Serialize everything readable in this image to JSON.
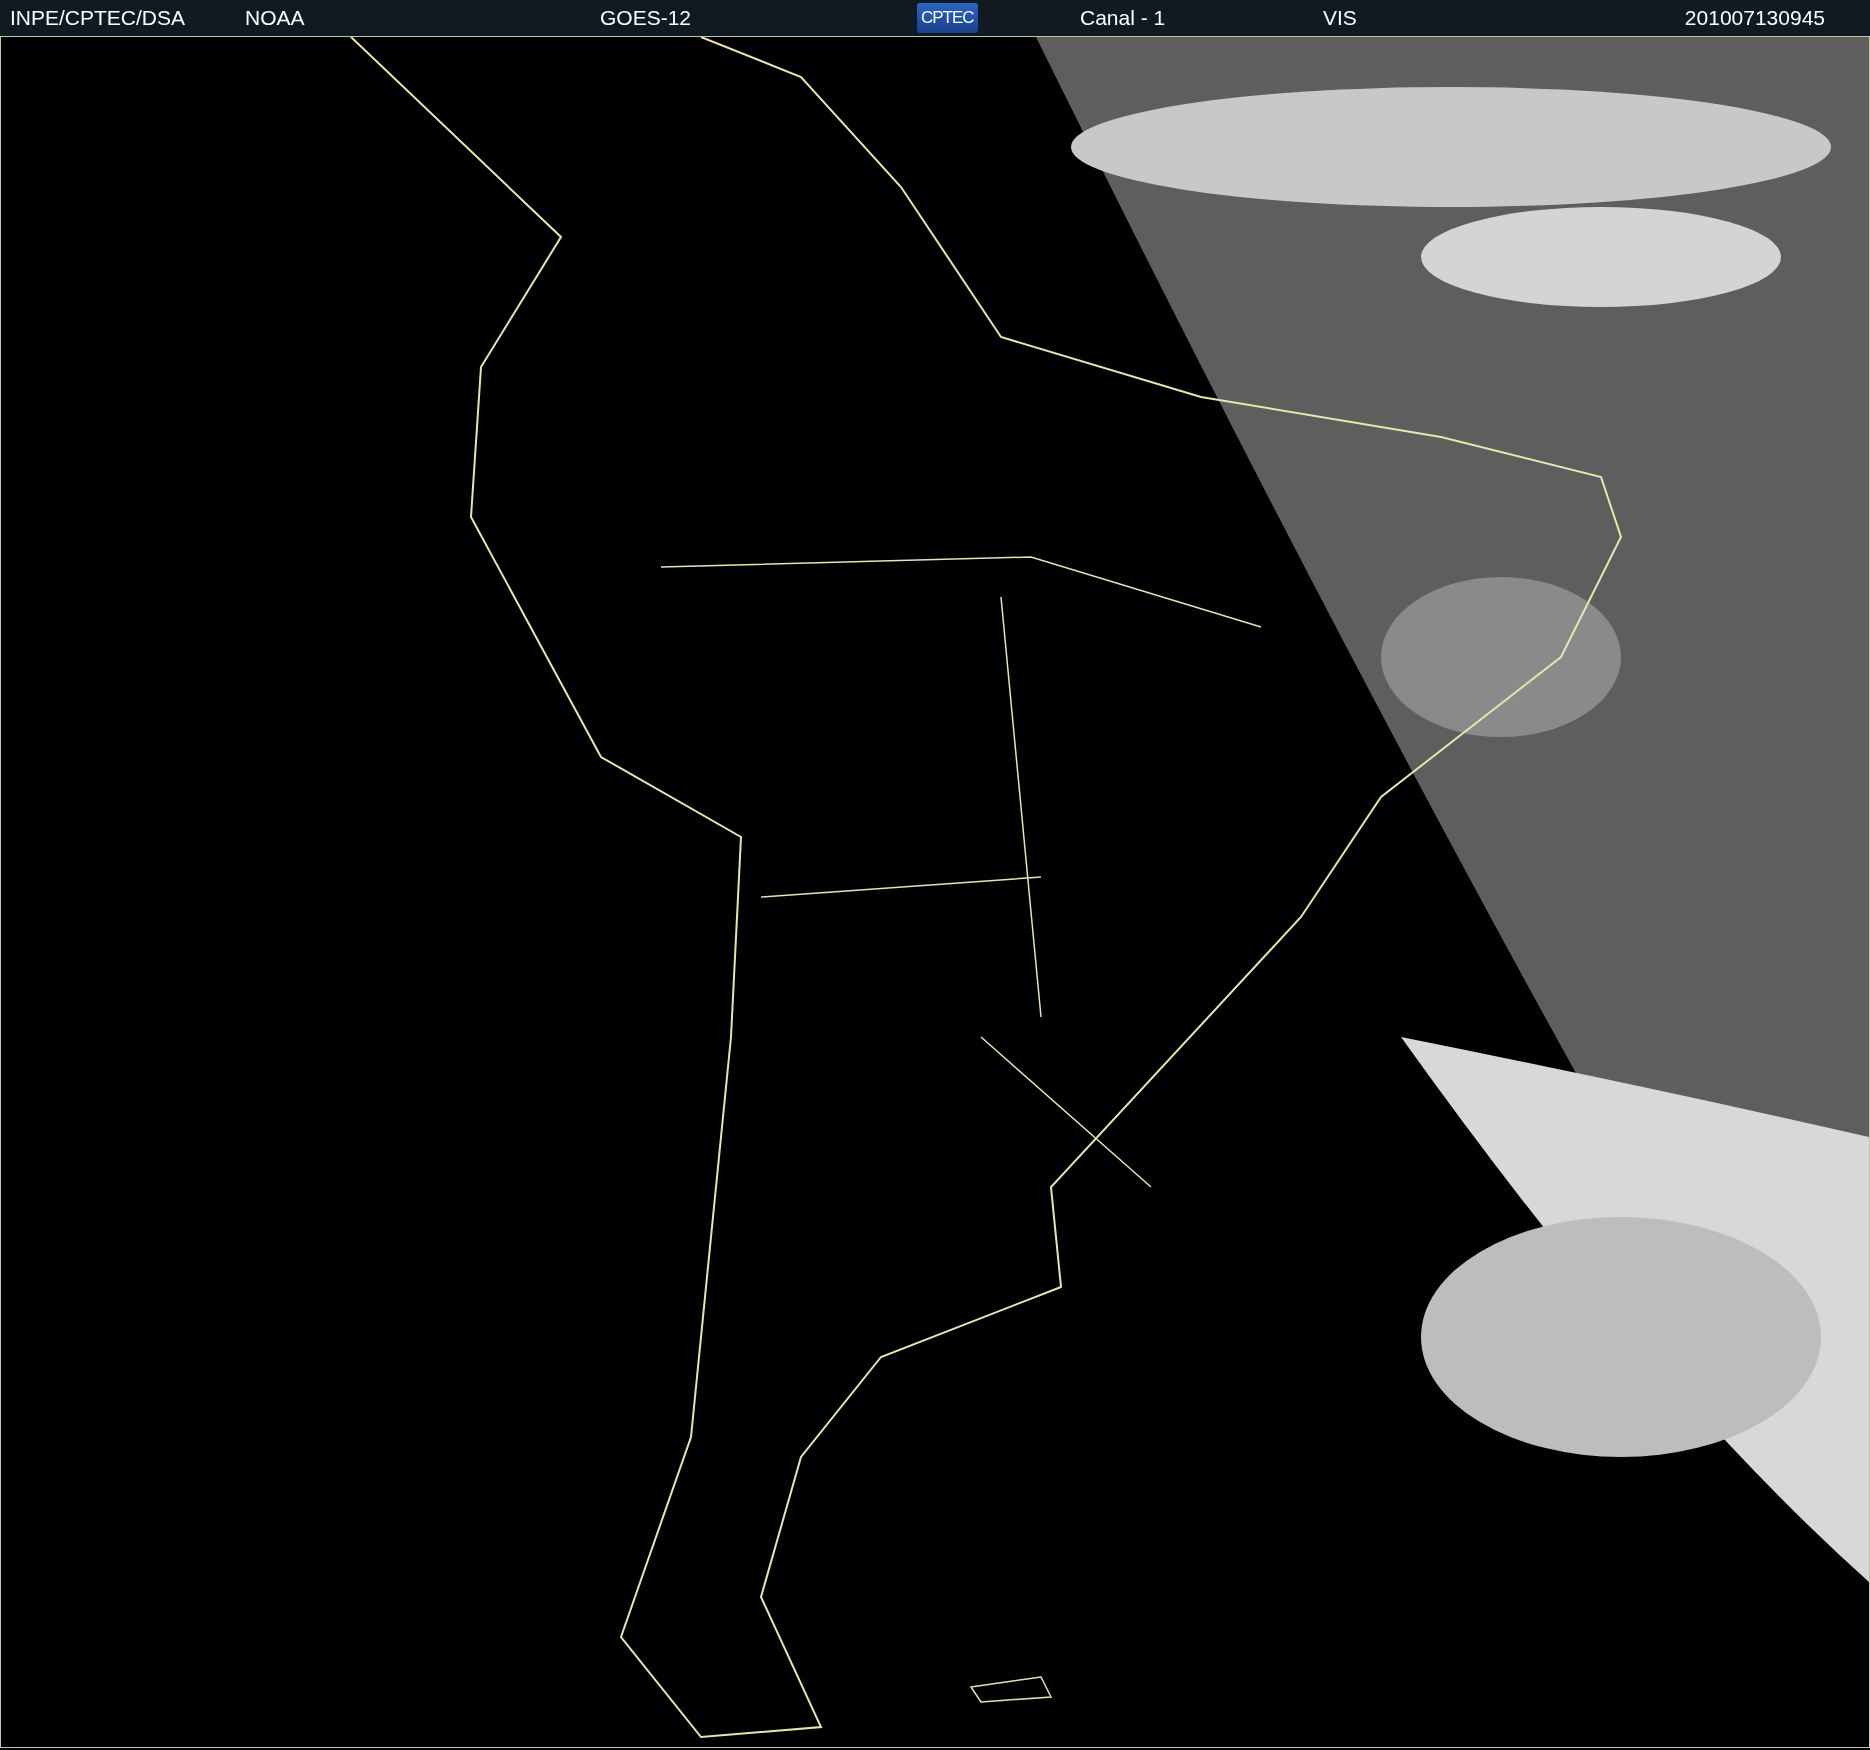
{
  "header": {
    "items": [
      {
        "kind": "text",
        "label": "INPE/CPTEC/DSA"
      },
      {
        "kind": "text",
        "label": "NOAA"
      },
      {
        "kind": "text",
        "label": "GOES-12"
      },
      {
        "kind": "logo",
        "label": "CPTEC"
      },
      {
        "kind": "text",
        "label": "Canal - 1"
      },
      {
        "kind": "text",
        "label": "VIS"
      },
      {
        "kind": "text",
        "label": "201007130945"
      }
    ]
  }
}
